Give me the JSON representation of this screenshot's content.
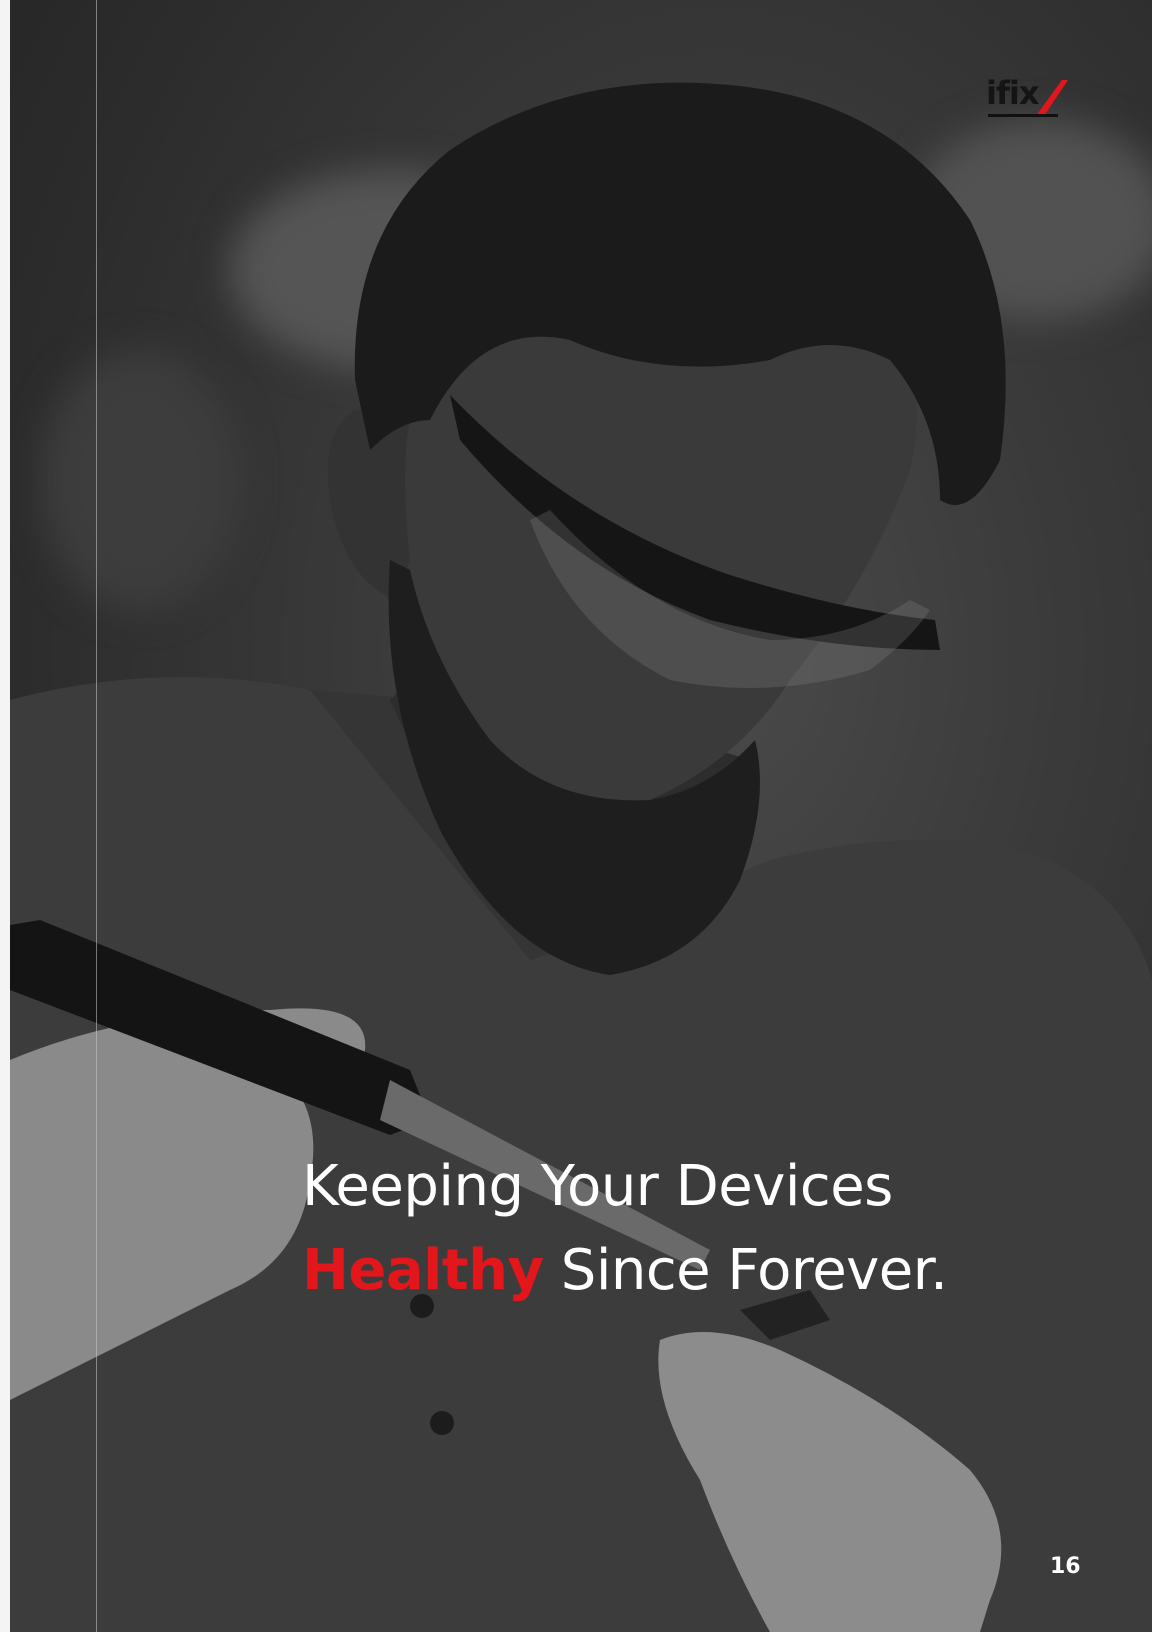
{
  "brand": {
    "logo_text": "ifix",
    "accent_color": "#e3161b"
  },
  "headline": {
    "line1": "Keeping Your Devices",
    "line2_accent": "Healthy",
    "line2_rest": " Since Forever."
  },
  "footer": {
    "page_number": "16"
  }
}
